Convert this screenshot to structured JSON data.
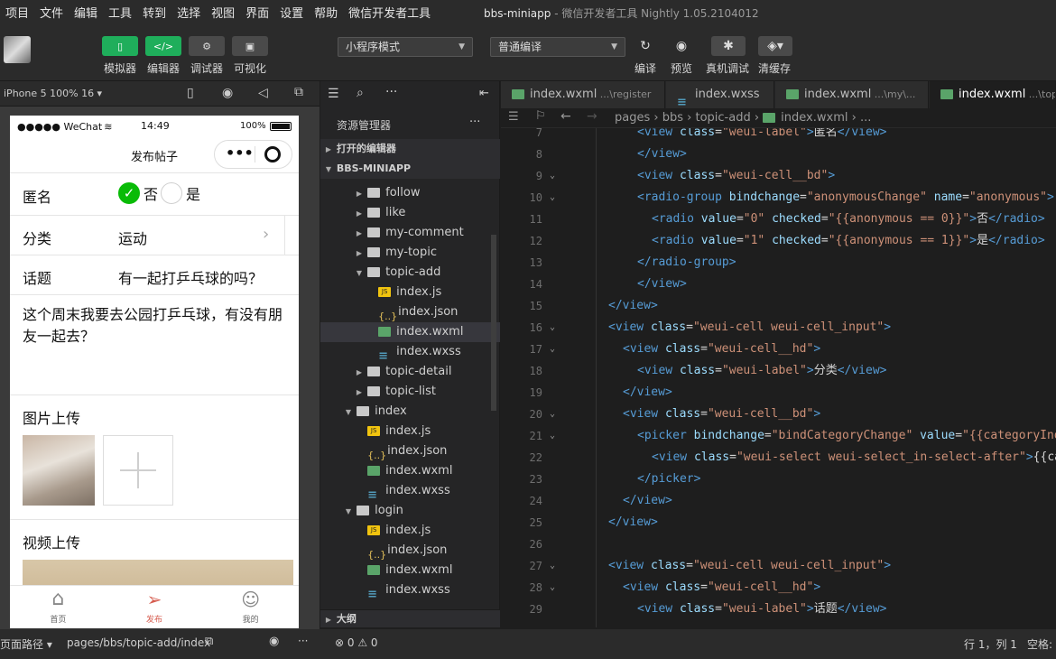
{
  "menubar": {
    "items": [
      "项目",
      "文件",
      "编辑",
      "工具",
      "转到",
      "选择",
      "视图",
      "界面",
      "设置",
      "帮助",
      "微信开发者工具"
    ],
    "window_title": "bbs-miniapp",
    "window_subtitle": "- 微信开发者工具 Nightly 1.05.2104012"
  },
  "toolbar": {
    "simulator_label": "模拟器",
    "editor_label": "编辑器",
    "debugger_label": "调试器",
    "visual_label": "可视化",
    "mode_select": "小程序模式",
    "compile_select": "普通编译",
    "compile_label": "编译",
    "preview_label": "预览",
    "remote_debug_label": "真机调试",
    "clear_cache_label": "清缓存"
  },
  "simulator": {
    "device": "iPhone 5 100% 16 ▾",
    "status": {
      "carrier": "●●●●● WeChat",
      "time": "14:49",
      "battery": "100%"
    },
    "nav_title": "发布帖子",
    "form": {
      "anonymous_label": "匿名",
      "no_label": "否",
      "yes_label": "是",
      "category_label": "分类",
      "category_value": "运动",
      "topic_label": "话题",
      "topic_value": "有一起打乒乓球的吗？",
      "content": "这个周末我要去公园打乒乓球，有没有朋友一起去？",
      "image_upload_label": "图片上传",
      "video_upload_label": "视频上传"
    },
    "tabbar": [
      {
        "label": "首页"
      },
      {
        "label": "发布"
      },
      {
        "label": "我的"
      }
    ]
  },
  "explorer": {
    "title": "资源管理器",
    "more": "···",
    "open_editors": "打开的编辑器",
    "project": "BBS-MINIAPP",
    "outline": "大纲",
    "tree": [
      {
        "label": "follow",
        "type": "folder",
        "indent": 2,
        "state": "closed"
      },
      {
        "label": "like",
        "type": "folder",
        "indent": 2,
        "state": "closed"
      },
      {
        "label": "my-comment",
        "type": "folder",
        "indent": 2,
        "state": "closed"
      },
      {
        "label": "my-topic",
        "type": "folder",
        "indent": 2,
        "state": "closed"
      },
      {
        "label": "topic-add",
        "type": "folder",
        "indent": 2,
        "state": "open"
      },
      {
        "label": "index.js",
        "type": "js",
        "indent": 3
      },
      {
        "label": "index.json",
        "type": "json",
        "indent": 3
      },
      {
        "label": "index.wxml",
        "type": "wxml",
        "indent": 3,
        "selected": true
      },
      {
        "label": "index.wxss",
        "type": "wxss",
        "indent": 3
      },
      {
        "label": "topic-detail",
        "type": "folder",
        "indent": 2,
        "state": "closed"
      },
      {
        "label": "topic-list",
        "type": "folder",
        "indent": 2,
        "state": "closed"
      },
      {
        "label": "index",
        "type": "folder",
        "indent": 1,
        "state": "open"
      },
      {
        "label": "index.js",
        "type": "js",
        "indent": 2
      },
      {
        "label": "index.json",
        "type": "json",
        "indent": 2
      },
      {
        "label": "index.wxml",
        "type": "wxml",
        "indent": 2
      },
      {
        "label": "index.wxss",
        "type": "wxss",
        "indent": 2
      },
      {
        "label": "login",
        "type": "folder",
        "indent": 1,
        "state": "open"
      },
      {
        "label": "index.js",
        "type": "js",
        "indent": 2
      },
      {
        "label": "index.json",
        "type": "json",
        "indent": 2
      },
      {
        "label": "index.wxml",
        "type": "wxml",
        "indent": 2
      },
      {
        "label": "index.wxss",
        "type": "wxss",
        "indent": 2
      }
    ]
  },
  "editor": {
    "tabs": [
      {
        "name": "index.wxml",
        "sub": "...\\register",
        "type": "wxml"
      },
      {
        "name": "index.wxss",
        "sub": "",
        "type": "wxss"
      },
      {
        "name": "index.wxml",
        "sub": "...\\my\\...",
        "type": "wxml"
      },
      {
        "name": "index.wxml",
        "sub": "...\\topic",
        "type": "wxml",
        "active": true
      }
    ],
    "breadcrumb": [
      "pages",
      "bbs",
      "topic-add",
      "index.wxml",
      "..."
    ],
    "lines": [
      {
        "n": "7",
        "fold": "",
        "indent": 2,
        "tokens": [
          [
            "tag",
            "<view "
          ],
          [
            "attr",
            "class"
          ],
          [
            "plain",
            "="
          ],
          [
            "str",
            "\"weui-label\""
          ],
          [
            "tag",
            ">"
          ],
          [
            "plain",
            "匿名"
          ],
          [
            "tag",
            "</view>"
          ]
        ]
      },
      {
        "n": "8",
        "fold": "",
        "indent": 2,
        "tokens": [
          [
            "tag",
            "</view>"
          ]
        ]
      },
      {
        "n": "9",
        "fold": "v",
        "indent": 2,
        "tokens": [
          [
            "tag",
            "<view "
          ],
          [
            "attr",
            "class"
          ],
          [
            "plain",
            "="
          ],
          [
            "str",
            "\"weui-cell__bd\""
          ],
          [
            "tag",
            ">"
          ]
        ]
      },
      {
        "n": "10",
        "fold": "v",
        "indent": 2,
        "tokens": [
          [
            "tag",
            "<radio-group "
          ],
          [
            "attr",
            "bindchange"
          ],
          [
            "plain",
            "="
          ],
          [
            "str",
            "\"anonymousChange\""
          ],
          [
            "attr",
            " name"
          ],
          [
            "plain",
            "="
          ],
          [
            "str",
            "\"anonymous\""
          ],
          [
            "tag",
            ">"
          ]
        ]
      },
      {
        "n": "11",
        "fold": "",
        "indent": 3,
        "tokens": [
          [
            "tag",
            "<radio "
          ],
          [
            "attr",
            "value"
          ],
          [
            "plain",
            "="
          ],
          [
            "str",
            "\"0\""
          ],
          [
            "attr",
            " checked"
          ],
          [
            "plain",
            "="
          ],
          [
            "str",
            "\"{{anonymous == 0}}\""
          ],
          [
            "tag",
            ">"
          ],
          [
            "plain",
            "否"
          ],
          [
            "tag",
            "</radio>"
          ]
        ]
      },
      {
        "n": "12",
        "fold": "",
        "indent": 3,
        "tokens": [
          [
            "tag",
            "<radio "
          ],
          [
            "attr",
            "value"
          ],
          [
            "plain",
            "="
          ],
          [
            "str",
            "\"1\""
          ],
          [
            "attr",
            " checked"
          ],
          [
            "plain",
            "="
          ],
          [
            "str",
            "\"{{anonymous == 1}}\""
          ],
          [
            "tag",
            ">"
          ],
          [
            "plain",
            "是"
          ],
          [
            "tag",
            "</radio>"
          ]
        ]
      },
      {
        "n": "13",
        "fold": "",
        "indent": 2,
        "tokens": [
          [
            "tag",
            "</radio-group>"
          ]
        ]
      },
      {
        "n": "14",
        "fold": "",
        "indent": 2,
        "tokens": [
          [
            "tag",
            "</view>"
          ]
        ]
      },
      {
        "n": "15",
        "fold": "",
        "indent": 0,
        "tokens": [
          [
            "tag",
            "</view>"
          ]
        ]
      },
      {
        "n": "16",
        "fold": "v",
        "indent": 0,
        "tokens": [
          [
            "tag",
            "<view "
          ],
          [
            "attr",
            "class"
          ],
          [
            "plain",
            "="
          ],
          [
            "str",
            "\"weui-cell weui-cell_input\""
          ],
          [
            "tag",
            ">"
          ]
        ]
      },
      {
        "n": "17",
        "fold": "v",
        "indent": 1,
        "tokens": [
          [
            "tag",
            "<view "
          ],
          [
            "attr",
            "class"
          ],
          [
            "plain",
            "="
          ],
          [
            "str",
            "\"weui-cell__hd\""
          ],
          [
            "tag",
            ">"
          ]
        ]
      },
      {
        "n": "18",
        "fold": "",
        "indent": 2,
        "tokens": [
          [
            "tag",
            "<view "
          ],
          [
            "attr",
            "class"
          ],
          [
            "plain",
            "="
          ],
          [
            "str",
            "\"weui-label\""
          ],
          [
            "tag",
            ">"
          ],
          [
            "plain",
            "分类"
          ],
          [
            "tag",
            "</view>"
          ]
        ]
      },
      {
        "n": "19",
        "fold": "",
        "indent": 1,
        "tokens": [
          [
            "tag",
            "</view>"
          ]
        ]
      },
      {
        "n": "20",
        "fold": "v",
        "indent": 1,
        "tokens": [
          [
            "tag",
            "<view "
          ],
          [
            "attr",
            "class"
          ],
          [
            "plain",
            "="
          ],
          [
            "str",
            "\"weui-cell__bd\""
          ],
          [
            "tag",
            ">"
          ]
        ]
      },
      {
        "n": "21",
        "fold": "v",
        "indent": 2,
        "tokens": [
          [
            "tag",
            "<picker "
          ],
          [
            "attr",
            "bindchange"
          ],
          [
            "plain",
            "="
          ],
          [
            "str",
            "\"bindCategoryChange\""
          ],
          [
            "attr",
            " value"
          ],
          [
            "plain",
            "="
          ],
          [
            "str",
            "\"{{categoryInde"
          ]
        ]
      },
      {
        "n": "22",
        "fold": "",
        "indent": 3,
        "tokens": [
          [
            "tag",
            "<view "
          ],
          [
            "attr",
            "class"
          ],
          [
            "plain",
            "="
          ],
          [
            "str",
            "\"weui-select weui-select_in-select-after\""
          ],
          [
            "tag",
            ">"
          ],
          [
            "plain",
            "{{cat"
          ]
        ]
      },
      {
        "n": "23",
        "fold": "",
        "indent": 2,
        "tokens": [
          [
            "tag",
            "</picker>"
          ]
        ]
      },
      {
        "n": "24",
        "fold": "",
        "indent": 1,
        "tokens": [
          [
            "tag",
            "</view>"
          ]
        ]
      },
      {
        "n": "25",
        "fold": "",
        "indent": 0,
        "tokens": [
          [
            "tag",
            "</view>"
          ]
        ]
      },
      {
        "n": "26",
        "fold": "",
        "indent": 0,
        "tokens": []
      },
      {
        "n": "27",
        "fold": "v",
        "indent": 0,
        "tokens": [
          [
            "tag",
            "<view "
          ],
          [
            "attr",
            "class"
          ],
          [
            "plain",
            "="
          ],
          [
            "str",
            "\"weui-cell weui-cell_input\""
          ],
          [
            "tag",
            ">"
          ]
        ]
      },
      {
        "n": "28",
        "fold": "v",
        "indent": 1,
        "tokens": [
          [
            "tag",
            "<view "
          ],
          [
            "attr",
            "class"
          ],
          [
            "plain",
            "="
          ],
          [
            "str",
            "\"weui-cell__hd\""
          ],
          [
            "tag",
            ">"
          ]
        ]
      },
      {
        "n": "29",
        "fold": "",
        "indent": 2,
        "tokens": [
          [
            "tag",
            "<view "
          ],
          [
            "attr",
            "class"
          ],
          [
            "plain",
            "="
          ],
          [
            "str",
            "\"weui-label\""
          ],
          [
            "tag",
            ">"
          ],
          [
            "plain",
            "话题"
          ],
          [
            "tag",
            "</view>"
          ]
        ]
      }
    ]
  },
  "statusbar": {
    "page_path_label": "页面路径 ▾",
    "page_path": "pages/bbs/topic-add/index",
    "problems": "⊗ 0 ⚠ 0",
    "cursor": "行 1，列 1",
    "spaces": "空格:"
  }
}
